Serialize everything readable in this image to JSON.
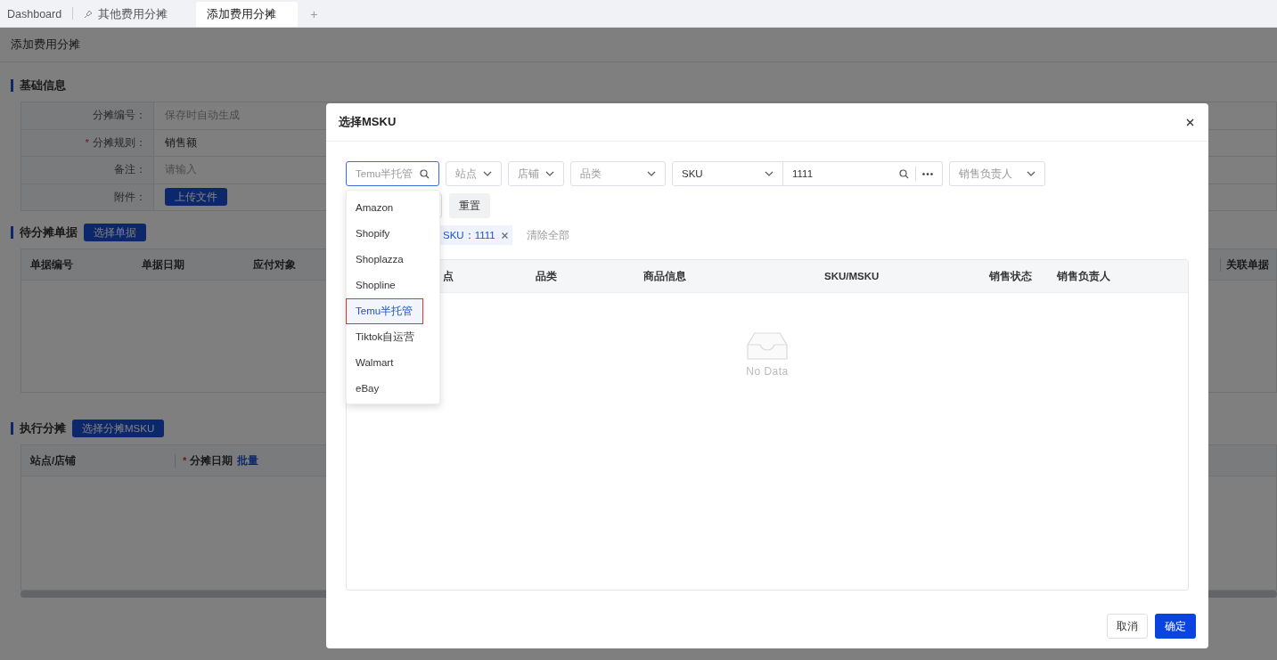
{
  "tabs": [
    {
      "label": "Dashboard",
      "selected": false,
      "pinned": false
    },
    {
      "label": "其他费用分摊",
      "selected": false,
      "pinned": true
    },
    {
      "label": "添加费用分摊",
      "selected": true,
      "pinned": false
    }
  ],
  "add_tab": "+",
  "page": {
    "title": "添加费用分摊",
    "basic": {
      "heading": "基础信息",
      "fields": [
        {
          "label": "分摊编号：",
          "kind": "hint",
          "placeholder": "保存时自动生成"
        },
        {
          "label": "分摊规则：",
          "marker": "*",
          "kind": "value",
          "value": "销售额"
        },
        {
          "label": "备注：",
          "kind": "hint",
          "placeholder": "请输入"
        },
        {
          "label": "附件：",
          "kind": "upload",
          "value": "上传文件"
        }
      ]
    },
    "pending": {
      "heading": "待分摊单据",
      "button": "选择单据",
      "columns": [
        "单据编号",
        "单据日期",
        "应付对象"
      ],
      "last_column": "关联单据"
    },
    "execute": {
      "heading": "执行分摊",
      "button": "选择分摊MSKU",
      "columns": [
        {
          "label": "站点/店铺"
        },
        {
          "label": "分摊日期",
          "marker": "*",
          "link": "批量"
        }
      ]
    }
  },
  "dialog": {
    "title": "选择MSKU",
    "filters": [
      {
        "kind": "search",
        "placeholder": "Temu半托管",
        "focused": true
      },
      {
        "kind": "select",
        "placeholder": "站点"
      },
      {
        "kind": "select",
        "placeholder": "店铺"
      },
      {
        "kind": "select",
        "placeholder": "品类"
      },
      {
        "kind": "combo",
        "field": "SKU",
        "value": "1111"
      },
      {
        "kind": "select",
        "placeholder": "销售负责人"
      }
    ],
    "reset_button": "重置",
    "tags": [
      {
        "label": "SKU：1111"
      }
    ],
    "clear_all": "清除全部",
    "table": {
      "columns": [
        "点",
        "品类",
        "商品信息",
        "SKU/MSKU",
        "销售状态",
        "销售负责人"
      ],
      "empty_text": "No Data"
    },
    "buttons": [
      {
        "label": "取消",
        "primary": false
      },
      {
        "label": "确定",
        "primary": true
      }
    ],
    "dropdown": {
      "options": [
        {
          "label": "Amazon",
          "selected": false
        },
        {
          "label": "Shopify",
          "selected": false
        },
        {
          "label": "Shoplazza",
          "selected": false
        },
        {
          "label": "Shopline",
          "selected": false
        },
        {
          "label": "Temu半托管",
          "selected": true
        },
        {
          "label": "Tiktok自运营",
          "selected": false
        },
        {
          "label": "Walmart",
          "selected": false
        },
        {
          "label": "eBay",
          "selected": false
        }
      ]
    }
  }
}
